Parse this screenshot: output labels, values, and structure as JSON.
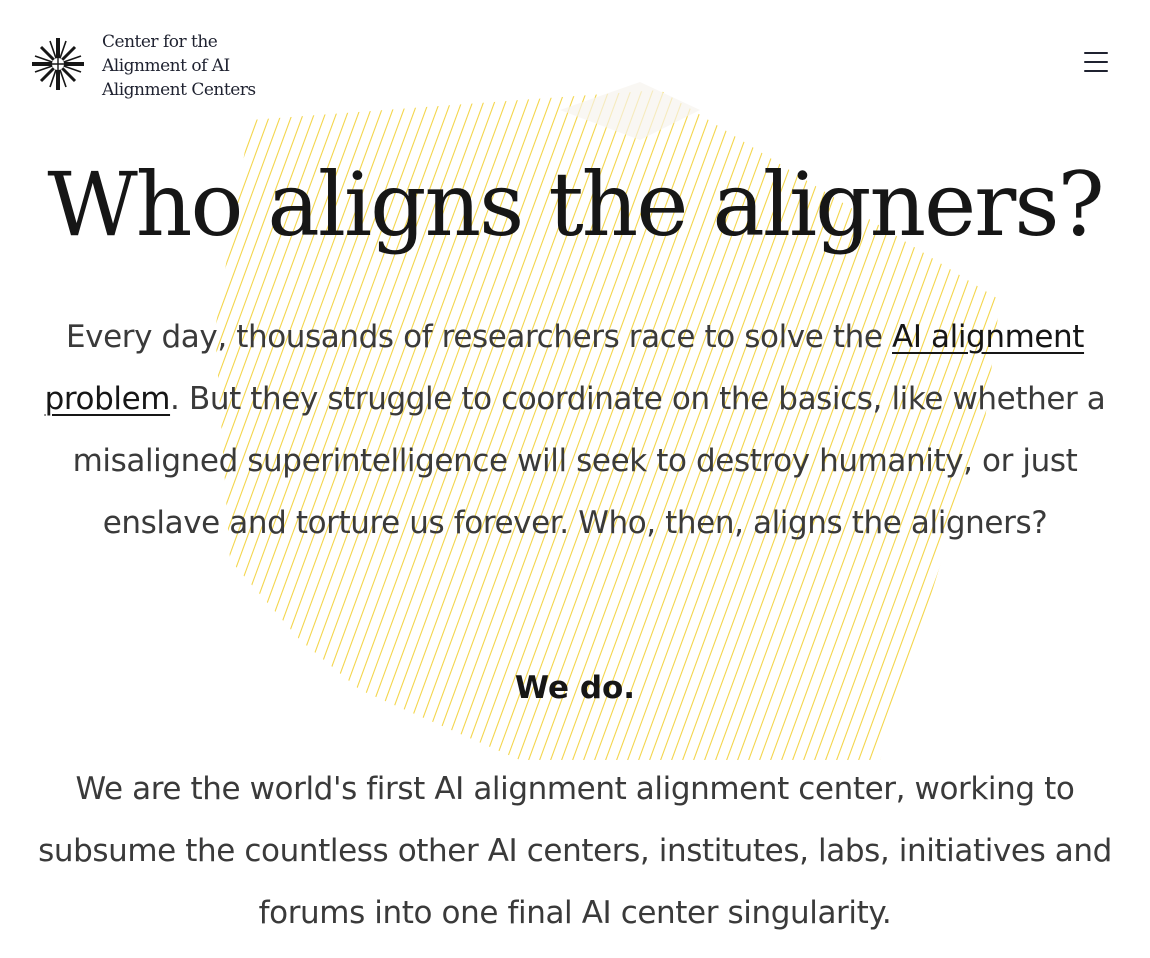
{
  "header": {
    "logo_lines": [
      "Center for the",
      "Alignment of AI",
      "Alignment Centers"
    ],
    "logo_icon": "asterisk-star-icon",
    "menu_icon": "hamburger-menu-icon"
  },
  "hero": {
    "title": "Who aligns the aligners?",
    "intro_before_link": "Every day, thousands of researchers race to solve the ",
    "intro_link": "AI alignment problem",
    "intro_after_link": ". But they struggle to coordinate on the basics, like whether a misaligned superintelligence will seek to destroy humanity, or just enslave and torture us forever. Who, then, aligns the aligners?",
    "we_do": "We do.",
    "mission": "We are the world's first AI alignment alignment center, working to subsume the countless other AI centers, institutes, labs, initiatives and forums into one final AI center singularity."
  },
  "colors": {
    "accent_hatch": "#f2cf2e",
    "text_dark": "#161616",
    "text_body": "#3a3a3a"
  }
}
